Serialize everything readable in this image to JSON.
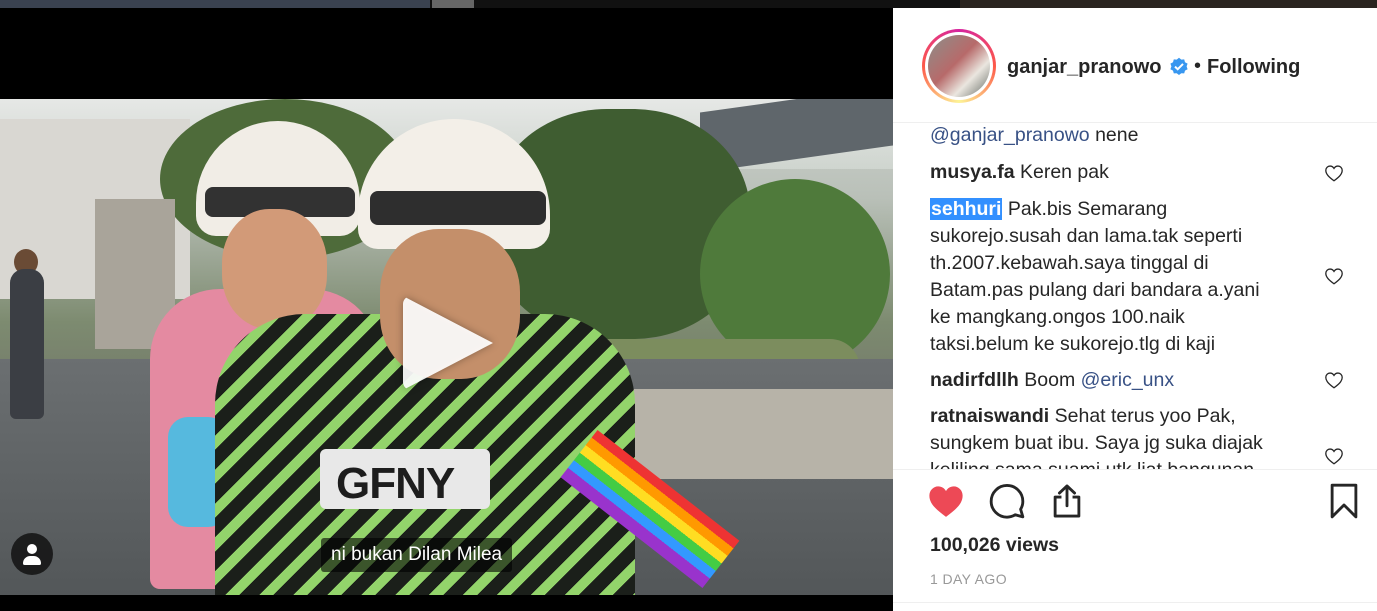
{
  "video": {
    "subtitle": "ni bukan Dilan Milea",
    "chest_print": "GFNY",
    "play_icon": "play-icon",
    "tag_icon": "user-tag-icon"
  },
  "post": {
    "username": "ganjar_pranowo",
    "verified_icon": "verified-badge-icon",
    "separator": "•",
    "follow_state": "Following",
    "views": "100,026 views",
    "time": "1 DAY AGO",
    "liked": true,
    "like_color": "#ed4956"
  },
  "comments": {
    "partial_mention": "@ganjar_pranowo",
    "partial_text": " nene",
    "items": [
      {
        "user": "musya.fa",
        "text": "Keren pak"
      },
      {
        "user": "sehhuri",
        "lines": [
          "Pak.bis Semarang",
          "sukorejo.susah dan lama.tak seperti",
          "th.2007.kebawah.saya tinggal di",
          "Batam.pas pulang dari bandara a.yani",
          "ke mangkang.ongos 100.naik",
          "taksi.belum ke sukorejo.tlg di kaji"
        ]
      },
      {
        "user": "nadirfdllh",
        "text": "Boom",
        "mention": "@eric_unx"
      },
      {
        "user": "ratnaiswandi",
        "lines": [
          "Sehat terus yoo Pak,",
          "sungkem buat ibu. Saya jg suka diajak",
          "keliling sama suami utk liat bangunan"
        ]
      }
    ]
  },
  "icons": {
    "like": "heart-filled-icon",
    "comment": "comment-icon",
    "share": "share-icon",
    "save": "bookmark-icon",
    "comment_like": "heart-outline-icon"
  }
}
